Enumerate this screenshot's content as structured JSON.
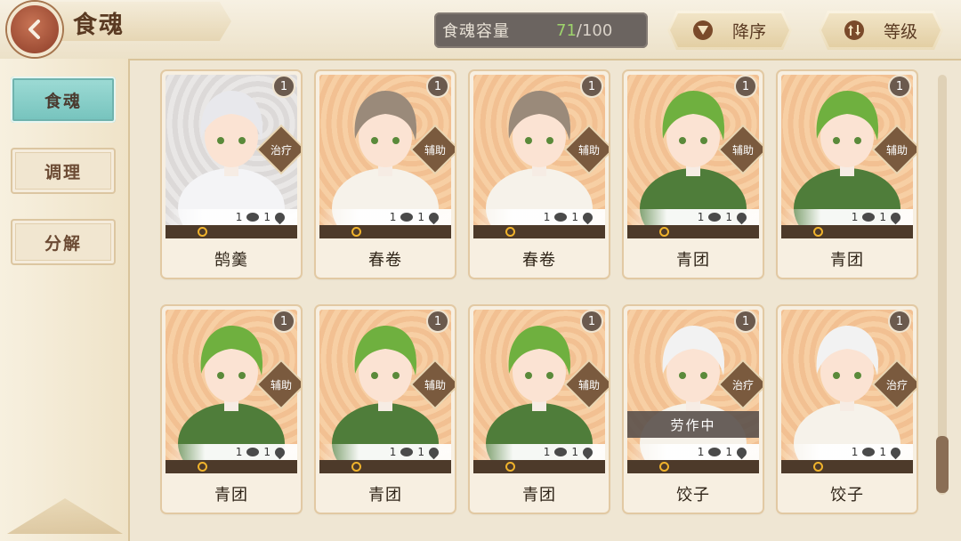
{
  "header": {
    "title": "食魂",
    "capacity_label": "食魂容量",
    "capacity_current": "71",
    "capacity_separator": "/",
    "capacity_max": "100",
    "sort_order_label": "降序",
    "sort_level_label": "等级"
  },
  "sidebar": {
    "tabs": [
      {
        "label": "食魂",
        "active": true
      },
      {
        "label": "调理",
        "active": false
      },
      {
        "label": "分解",
        "active": false
      }
    ]
  },
  "cards": [
    {
      "name": "鹄羹",
      "level": "1",
      "role": "治疗",
      "stat_a": "1",
      "stat_b": "1",
      "theme": "silver",
      "hair": "#e8e8ec",
      "status": ""
    },
    {
      "name": "春卷",
      "level": "1",
      "role": "辅助",
      "stat_a": "1",
      "stat_b": "1",
      "theme": "orange",
      "hair": "#9a8a7a",
      "status": ""
    },
    {
      "name": "春卷",
      "level": "1",
      "role": "辅助",
      "stat_a": "1",
      "stat_b": "1",
      "theme": "orange",
      "hair": "#9a8a7a",
      "status": ""
    },
    {
      "name": "青团",
      "level": "1",
      "role": "辅助",
      "stat_a": "1",
      "stat_b": "1",
      "theme": "orange",
      "hair": "#6fb03f",
      "status": ""
    },
    {
      "name": "青团",
      "level": "1",
      "role": "辅助",
      "stat_a": "1",
      "stat_b": "1",
      "theme": "orange",
      "hair": "#6fb03f",
      "status": ""
    },
    {
      "name": "青团",
      "level": "1",
      "role": "辅助",
      "stat_a": "1",
      "stat_b": "1",
      "theme": "orange",
      "hair": "#6fb03f",
      "status": ""
    },
    {
      "name": "青团",
      "level": "1",
      "role": "辅助",
      "stat_a": "1",
      "stat_b": "1",
      "theme": "orange",
      "hair": "#6fb03f",
      "status": ""
    },
    {
      "name": "青团",
      "level": "1",
      "role": "辅助",
      "stat_a": "1",
      "stat_b": "1",
      "theme": "orange",
      "hair": "#6fb03f",
      "status": ""
    },
    {
      "name": "饺子",
      "level": "1",
      "role": "治疗",
      "stat_a": "1",
      "stat_b": "1",
      "theme": "orange",
      "hair": "#f2f2f2",
      "status": "劳作中"
    },
    {
      "name": "饺子",
      "level": "1",
      "role": "治疗",
      "stat_a": "1",
      "stat_b": "1",
      "theme": "orange",
      "hair": "#f2f2f2",
      "status": ""
    }
  ],
  "colors": {
    "capacity_current": "#9ed46c",
    "active_tab": "#74c2bc",
    "card_border": "#e2c9a3"
  }
}
